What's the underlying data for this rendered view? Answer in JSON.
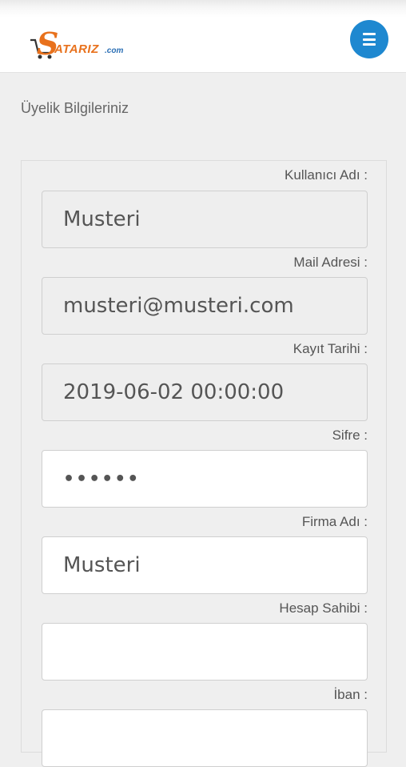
{
  "header": {
    "logo_text": "SATARIZ.com",
    "menu_icon": "hamburger-menu-icon",
    "accent_color": "#1e88d0"
  },
  "page": {
    "title": "Üyelik Bilgileriniz"
  },
  "form": {
    "fields": [
      {
        "label": "Kullanıcı Adı :",
        "value": "Musteri",
        "editable": false
      },
      {
        "label": "Mail Adresi :",
        "value": "musteri@musteri.com",
        "editable": false
      },
      {
        "label": "Kayıt Tarihi :",
        "value": "2019-06-02 00:00:00",
        "editable": false
      },
      {
        "label": "Sifre :",
        "value": "••••••",
        "editable": true
      },
      {
        "label": "Firma Adı :",
        "value": "Musteri",
        "editable": true
      },
      {
        "label": "Hesap Sahibi :",
        "value": "",
        "editable": true
      },
      {
        "label": "İban :",
        "value": "",
        "editable": true
      }
    ]
  }
}
